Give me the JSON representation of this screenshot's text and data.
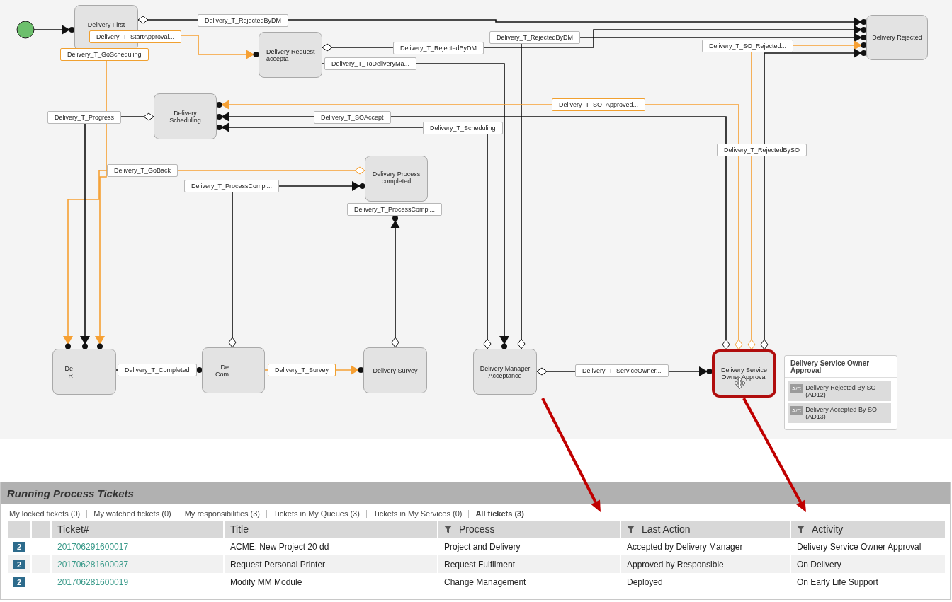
{
  "diagram": {
    "nodes": [
      {
        "lines": [
          "Delivery First"
        ],
        "selected": false
      },
      {
        "lines": [
          "Delivery Request",
          "accepta"
        ],
        "selected": false
      },
      {
        "lines": [
          "Delivery",
          "Scheduling"
        ],
        "selected": false
      },
      {
        "lines": [
          "Delivery Process",
          "completed"
        ],
        "selected": false
      },
      {
        "lines": [
          "De",
          "R"
        ],
        "selected": false
      },
      {
        "lines": [
          "De",
          "Com"
        ],
        "selected": false
      },
      {
        "lines": [
          "Delivery Survey"
        ],
        "selected": false
      },
      {
        "lines": [
          "Delivery Manager",
          "Acceptance"
        ],
        "selected": false
      },
      {
        "lines": [
          "Delivery Service",
          "Owner Approval"
        ],
        "selected": true
      },
      {
        "lines": [
          "Delivery Rejected"
        ],
        "selected": false
      }
    ],
    "transitions": [
      {
        "label": "Delivery_T_RejectedByDM",
        "highlighted": false
      },
      {
        "label": "Delivery_T_StartApproval...",
        "highlighted": true
      },
      {
        "label": "Delivery_T_GoScheduling",
        "highlighted": true
      },
      {
        "label": "Delivery_T_RejectedByDM",
        "highlighted": false
      },
      {
        "label": "Delivery_T_RejectedByDM",
        "highlighted": false
      },
      {
        "label": "Delivery_T_ToDeliveryMa...",
        "highlighted": false
      },
      {
        "label": "Delivery_T_SO_Rejected...",
        "highlighted": false
      },
      {
        "label": "Delivery_T_SO_Approved...",
        "highlighted": true
      },
      {
        "label": "Delivery_T_Progress",
        "highlighted": false
      },
      {
        "label": "Delivery_T_SOAccept",
        "highlighted": false
      },
      {
        "label": "Delivery_T_Scheduling",
        "highlighted": false
      },
      {
        "label": "Delivery_T_RejectedBySO",
        "highlighted": false
      },
      {
        "label": "Delivery_T_GoBack",
        "highlighted": false
      },
      {
        "label": "Delivery_T_ProcessCompl...",
        "highlighted": false
      },
      {
        "label": "Delivery_T_ProcessCompl...",
        "highlighted": false
      },
      {
        "label": "Delivery_T_Completed",
        "highlighted": false
      },
      {
        "label": "Delivery_T_Survey",
        "highlighted": true
      },
      {
        "label": "Delivery_T_ServiceOwner...",
        "highlighted": false
      }
    ],
    "popup": {
      "title": "Delivery Service Owner Approval",
      "items": [
        {
          "badge": "A/C",
          "text": "Delivery Rejected By SO (AD12)"
        },
        {
          "badge": "A/C",
          "text": "Delivery Accepted By SO (AD13)"
        }
      ]
    }
  },
  "tickets": {
    "title": "Running Process Tickets",
    "filters": [
      {
        "label": "My locked tickets (0)",
        "selected": false
      },
      {
        "label": "My watched tickets (0)",
        "selected": false
      },
      {
        "label": "My responsibilities (3)",
        "selected": false
      },
      {
        "label": "Tickets in My Queues (3)",
        "selected": false
      },
      {
        "label": "Tickets in My Services (0)",
        "selected": false
      },
      {
        "label": "All tickets (3)",
        "selected": true
      }
    ],
    "columns": [
      {
        "filter": false
      },
      {
        "filter": false
      },
      {
        "label": "Ticket#",
        "filter": false
      },
      {
        "label": "Title",
        "filter": false
      },
      {
        "label": "Process",
        "filter": true
      },
      {
        "label": "Last Action",
        "filter": true
      },
      {
        "label": "Activity",
        "filter": true
      }
    ],
    "rows": [
      {
        "priority": "2",
        "ticket": "201706291600017",
        "title": "ACME: New Project 20 dd",
        "process": "Project and Delivery",
        "last_action": "Accepted by Delivery Manager",
        "activity": "Delivery Service Owner Approval"
      },
      {
        "priority": "2",
        "ticket": "201706281600037",
        "title": "Request Personal Printer",
        "process": "Request Fulfilment",
        "last_action": "Approved by Responsible",
        "activity": "On Delivery"
      },
      {
        "priority": "2",
        "ticket": "201706281600019",
        "title": "Modify MM Module",
        "process": "Change Management",
        "last_action": "Deployed",
        "activity": "On Early Life Support"
      }
    ]
  }
}
